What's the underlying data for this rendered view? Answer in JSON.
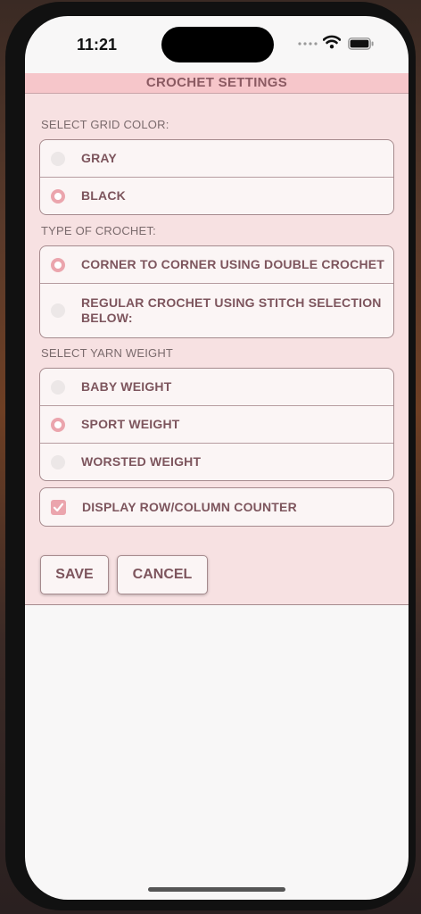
{
  "status": {
    "time": "11:21"
  },
  "header": {
    "title": "CROCHET SETTINGS"
  },
  "grid_color": {
    "label": "SELECT GRID COLOR:",
    "options": [
      {
        "label": "GRAY",
        "selected": false
      },
      {
        "label": "BLACK",
        "selected": true
      }
    ]
  },
  "crochet_type": {
    "label": "TYPE OF CROCHET:",
    "options": [
      {
        "label": "CORNER TO CORNER USING DOUBLE CROCHET",
        "selected": true
      },
      {
        "label": "REGULAR CROCHET USING STITCH SELECTION BELOW:",
        "selected": false
      }
    ]
  },
  "yarn_weight": {
    "label": "SELECT YARN WEIGHT",
    "options": [
      {
        "label": "BABY WEIGHT",
        "selected": false
      },
      {
        "label": "SPORT WEIGHT",
        "selected": true
      },
      {
        "label": "WORSTED WEIGHT",
        "selected": false
      }
    ]
  },
  "counter": {
    "label": "DISPLAY ROW/COLUMN COUNTER",
    "checked": true
  },
  "actions": {
    "save_label": "SAVE",
    "cancel_label": "CANCEL"
  },
  "colors": {
    "accent": "#eba5ad",
    "header_bg": "#f6c6ca",
    "panel_bg": "#f7e1e2",
    "text": "#7d555d"
  }
}
